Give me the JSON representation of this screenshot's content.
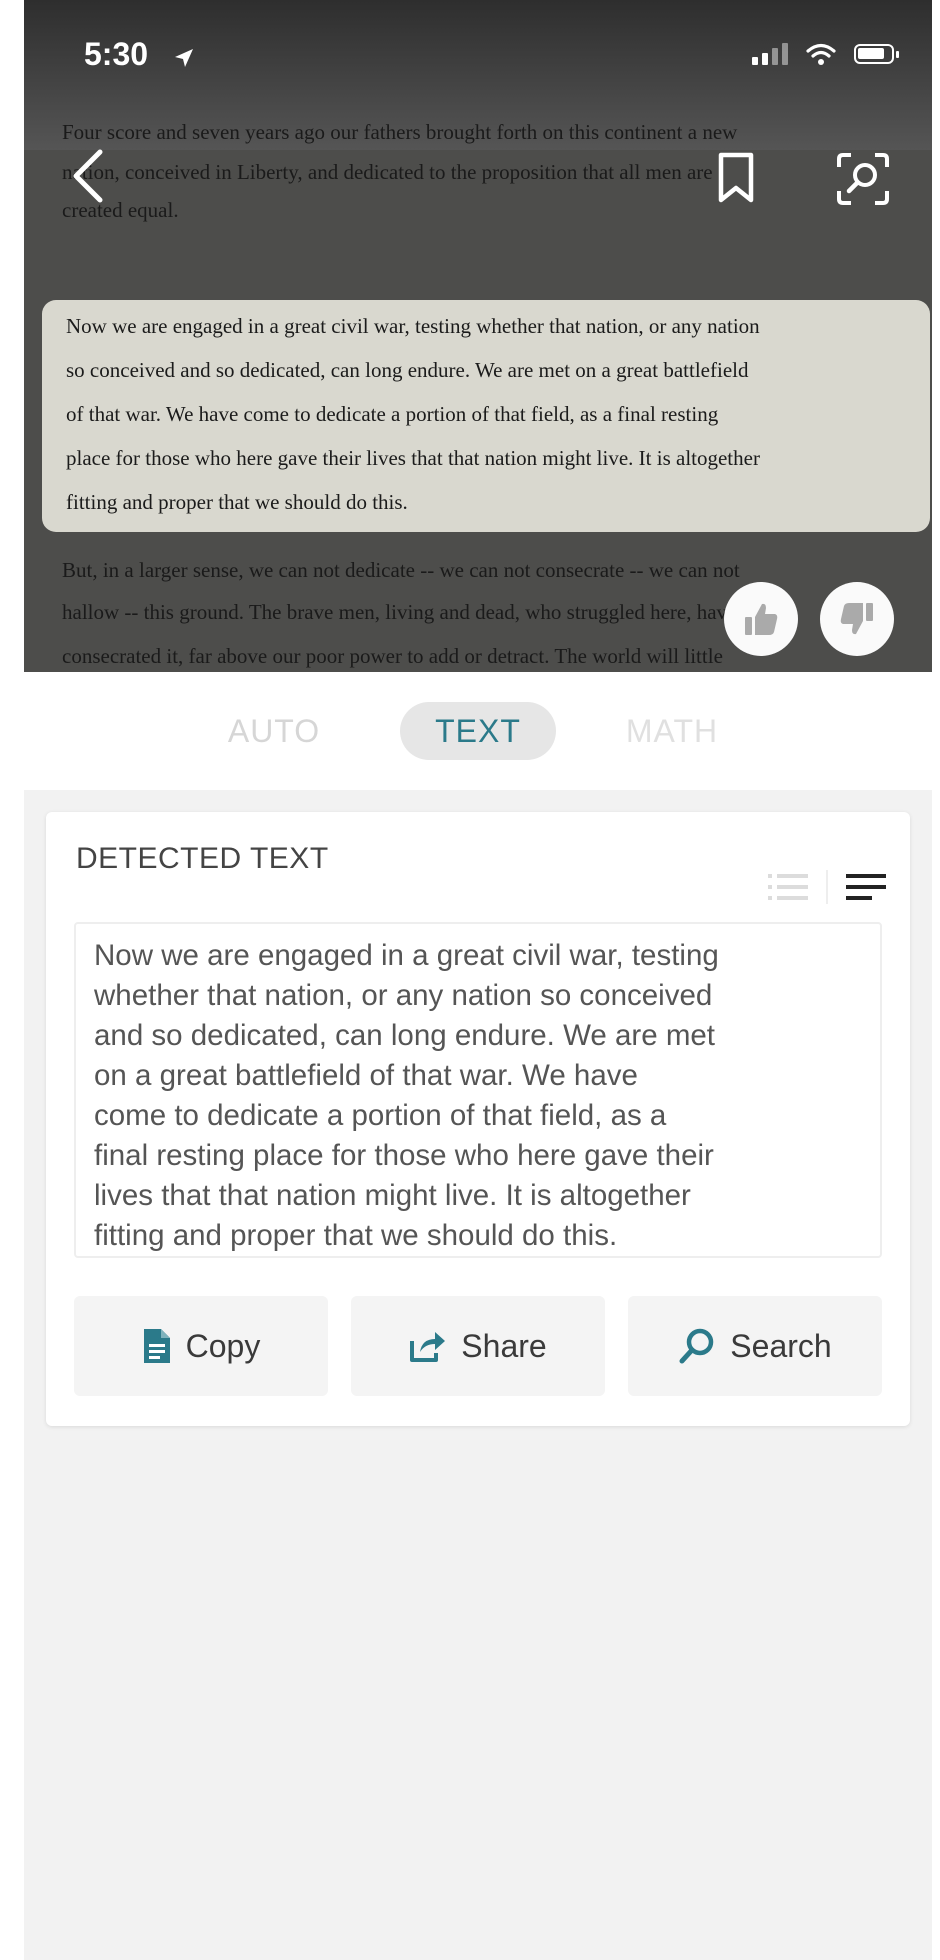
{
  "status_bar": {
    "time": "5:30"
  },
  "camera": {
    "paper_lines_before": [
      "Four score and seven years ago our fathers brought forth on this continent a new",
      "nation, conceived in Liberty, and dedicated to the proposition that all men are",
      "created equal."
    ],
    "highlighted_lines": [
      "Now we are engaged in a great civil war, testing whether that nation, or any nation",
      "so conceived and so dedicated, can long endure. We are met on a great battlefield",
      "of that war. We have come to dedicate a portion of that field, as a final resting",
      "place for those who here gave their lives that that nation might live. It is altogether",
      "fitting and proper that we should do this."
    ],
    "paper_lines_after": [
      "But, in a larger sense, we can not dedicate -- we can not consecrate -- we can not",
      "hallow -- this ground. The brave men, living and dead, who struggled here, have",
      "consecrated it, far above our poor power to add or detract. The world will little"
    ]
  },
  "modes": {
    "auto": "AUTO",
    "text": "TEXT",
    "math": "MATH",
    "selected": "TEXT"
  },
  "result": {
    "title": "DETECTED TEXT",
    "text": "Now we are engaged in a great civil war, testing\nwhether that nation, or any nation so conceived\nand so dedicated, can long endure. We are met\non a great battlefield of that war. We have\ncome to dedicate a portion of that field, as a\nfinal resting place for those who here gave their\nlives that that nation might live. It is altogether\nfitting and proper that we should do this.",
    "actions": {
      "copy": "Copy",
      "share": "Share",
      "search": "Search"
    }
  },
  "colors": {
    "accent": "#2b7a8a",
    "card_bg": "#ffffff",
    "page_bg": "#f2f2f2"
  },
  "icons": {
    "back": "chevron-left-icon",
    "bookmark": "bookmark-icon",
    "visual_search": "visual-search-icon",
    "like": "thumbs-up-icon",
    "dislike": "thumbs-down-icon",
    "list_view": "list-view-icon",
    "paragraph_view": "paragraph-view-icon",
    "copy": "document-icon",
    "share": "share-icon",
    "search": "search-icon"
  }
}
